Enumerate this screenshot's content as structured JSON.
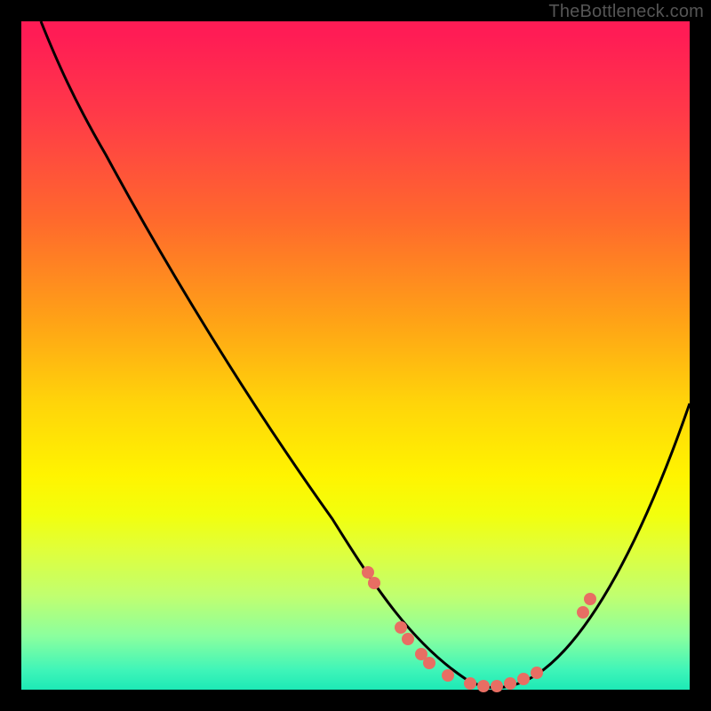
{
  "watermark": "TheBottleneck.com",
  "chart_data": {
    "type": "line",
    "title": "",
    "xlabel": "",
    "ylabel": "",
    "xlim": [
      0,
      100
    ],
    "ylim": [
      0,
      100
    ],
    "grid": false,
    "background_gradient": [
      "#ff1c55",
      "#ffd40a",
      "#1de9b6"
    ],
    "curve": {
      "name": "bottleneck-curve",
      "color": "#000000",
      "points": [
        {
          "x": 3,
          "y": 100
        },
        {
          "x": 10,
          "y": 90
        },
        {
          "x": 17,
          "y": 78
        },
        {
          "x": 25,
          "y": 64
        },
        {
          "x": 33,
          "y": 50
        },
        {
          "x": 41,
          "y": 35
        },
        {
          "x": 48,
          "y": 22
        },
        {
          "x": 53,
          "y": 12
        },
        {
          "x": 58,
          "y": 5
        },
        {
          "x": 64,
          "y": 1
        },
        {
          "x": 70,
          "y": 0
        },
        {
          "x": 76,
          "y": 2
        },
        {
          "x": 82,
          "y": 8
        },
        {
          "x": 88,
          "y": 18
        },
        {
          "x": 94,
          "y": 30
        },
        {
          "x": 100,
          "y": 43
        }
      ]
    },
    "markers": {
      "name": "sample-points",
      "color": "#e86e63",
      "radius": 7,
      "points": [
        {
          "x": 52,
          "y": 17
        },
        {
          "x": 53,
          "y": 15
        },
        {
          "x": 57,
          "y": 9
        },
        {
          "x": 58,
          "y": 7
        },
        {
          "x": 60,
          "y": 5
        },
        {
          "x": 61,
          "y": 3.5
        },
        {
          "x": 64,
          "y": 1
        },
        {
          "x": 67,
          "y": 0.5
        },
        {
          "x": 69,
          "y": 0.3
        },
        {
          "x": 71,
          "y": 0.3
        },
        {
          "x": 73,
          "y": 0.6
        },
        {
          "x": 75,
          "y": 1.2
        },
        {
          "x": 77,
          "y": 2
        },
        {
          "x": 84,
          "y": 11
        },
        {
          "x": 85,
          "y": 13
        }
      ]
    }
  }
}
